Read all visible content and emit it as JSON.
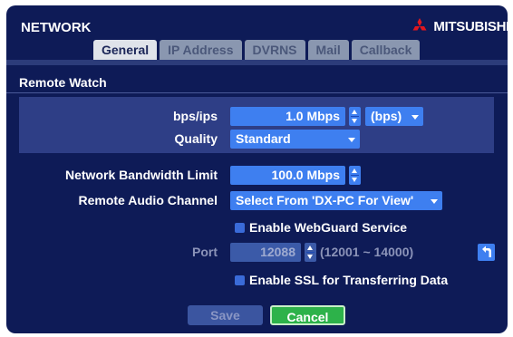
{
  "window": {
    "title": "NETWORK",
    "brand": "MITSUBISHI",
    "brand_color": "#e1161e",
    "accent": "#3e7ff0"
  },
  "tabs": [
    {
      "label": "General",
      "active": true
    },
    {
      "label": "IP Address",
      "active": false
    },
    {
      "label": "DVRNS",
      "active": false
    },
    {
      "label": "Mail",
      "active": false
    },
    {
      "label": "Callback",
      "active": false
    }
  ],
  "remote_watch": {
    "title": "Remote Watch",
    "bps_label": "bps/ips",
    "bps_value": "1.0 Mbps",
    "unit_value": "(bps)",
    "quality_label": "Quality",
    "quality_value": "Standard"
  },
  "bandwidth": {
    "label": "Network Bandwidth Limit",
    "value": "100.0 Mbps"
  },
  "audio": {
    "label": "Remote Audio Channel",
    "value": "Select From 'DX-PC For View'"
  },
  "webguard": {
    "label": "Enable WebGuard Service",
    "checked": false
  },
  "port": {
    "label": "Port",
    "value": "12088",
    "range": "(12001 ~ 14000)",
    "enabled": false
  },
  "ssl": {
    "label": "Enable SSL for Transferring Data",
    "checked": false
  },
  "buttons": {
    "save": "Save",
    "cancel": "Cancel"
  },
  "icons": {
    "logo": "mitsubishi-diamonds-icon",
    "undo": "undo-arrow-icon"
  }
}
